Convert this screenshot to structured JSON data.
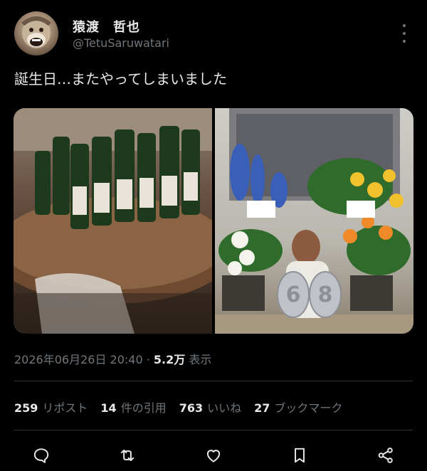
{
  "author": {
    "name": "猿渡　哲也",
    "handle": "@TetuSaruwatari"
  },
  "tweet": {
    "text": "誕生日…またやってしまいました"
  },
  "media": {
    "left_photo": "wine-bottles",
    "right_photo": "flowers-balloon-68",
    "balloon_number": "68"
  },
  "meta": {
    "datetime": "2026年06月26日 20:40",
    "separator": "·",
    "views_count": "5.2万",
    "views_label": "表示"
  },
  "stats": {
    "reposts_count": "259",
    "reposts_label": "リポスト",
    "quotes_count": "14",
    "quotes_label": "件の引用",
    "likes_count": "763",
    "likes_label": "いいね",
    "bookmarks_count": "27",
    "bookmarks_label": "ブックマーク"
  },
  "actions": [
    "reply-icon",
    "repost-icon",
    "like-icon",
    "bookmark-icon",
    "share-icon"
  ],
  "colors": {
    "background": "#000000",
    "text_primary": "#e7e9ea",
    "text_secondary": "#71767b",
    "divider": "#2f3336"
  }
}
